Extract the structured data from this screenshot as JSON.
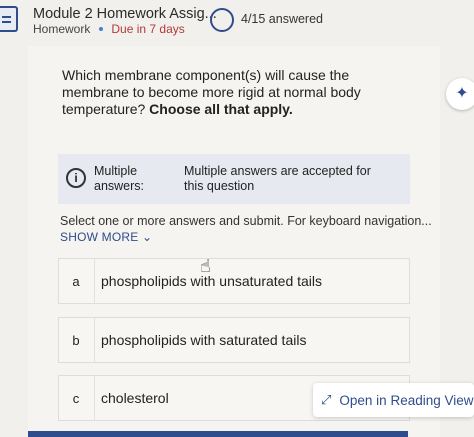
{
  "header": {
    "title": "Module 2 Homework Assig...",
    "type": "Homework",
    "due": "Due in 7 days",
    "answered": "4/15 answered"
  },
  "question": {
    "text": "Which membrane component(s) will cause the membrane to become more rigid at normal body temperature? ",
    "emphasis": "Choose all that apply."
  },
  "info": {
    "label": "Multiple answers:",
    "text": "Multiple answers are accepted for this question"
  },
  "instructions": "Select one or more answers and submit. For keyboard navigation...",
  "show_more": "SHOW MORE",
  "options": [
    {
      "letter": "a",
      "text": "phospholipids with unsaturated tails"
    },
    {
      "letter": "b",
      "text": "phospholipids with saturated tails"
    },
    {
      "letter": "c",
      "text": "cholesterol"
    }
  ],
  "reading_view": "Open in Reading View",
  "colors": {
    "accent": "#2f4c8c",
    "due": "#b23a3a"
  }
}
